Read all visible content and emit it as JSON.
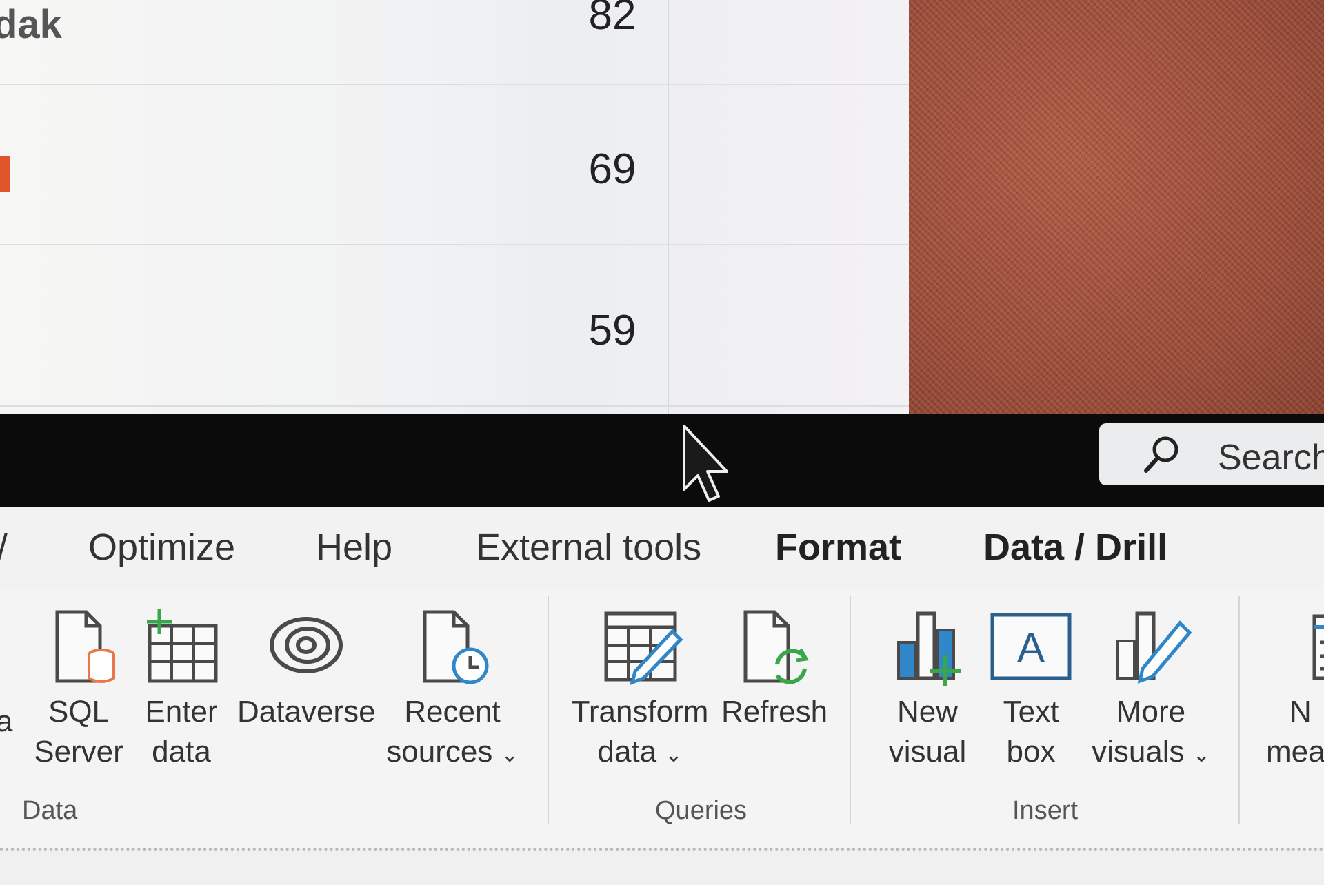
{
  "table": {
    "row_partial_label": "dak",
    "values": [
      "82",
      "69",
      "59"
    ],
    "accent_color": "#e0562a"
  },
  "title_bar": {
    "search": {
      "label": "Search",
      "icon": "search-icon"
    }
  },
  "menu": {
    "tabs": [
      {
        "label": "Optimize"
      },
      {
        "label": "Help"
      },
      {
        "label": "External tools"
      },
      {
        "label": "Format"
      },
      {
        "label": "Data / Drill"
      }
    ]
  },
  "ribbon": {
    "groups": {
      "data": "Data",
      "queries": "Queries",
      "insert": "Insert"
    },
    "buttons": {
      "partial_left": "a",
      "sql_server": {
        "line1": "SQL",
        "line2": "Server",
        "icon": "sql-server-icon"
      },
      "enter_data": {
        "line1": "Enter",
        "line2": "data",
        "icon": "enter-data-icon"
      },
      "dataverse": {
        "line1": "Dataverse",
        "icon": "dataverse-icon"
      },
      "recent_sources": {
        "line1": "Recent",
        "line2": "sources",
        "icon": "recent-sources-icon"
      },
      "transform_data": {
        "line1": "Transform",
        "line2": "data",
        "icon": "transform-data-icon"
      },
      "refresh": {
        "line1": "Refresh",
        "icon": "refresh-icon"
      },
      "new_visual": {
        "line1": "New",
        "line2": "visual",
        "icon": "new-visual-icon"
      },
      "text_box": {
        "line1": "Text",
        "line2": "box",
        "icon": "text-box-icon"
      },
      "more_visuals": {
        "line1": "More",
        "line2": "visuals",
        "icon": "more-visuals-icon"
      },
      "new_measure_partial": {
        "line1": "N",
        "line2": "mea",
        "icon": "new-measure-icon"
      }
    },
    "caret": "⌄"
  },
  "colors": {
    "title_bar": "#0b0b0b",
    "desktop": "#a6503a",
    "icon_outline": "#4a4a4a",
    "accent_blue": "#2f86c9",
    "accent_green": "#3aa64a",
    "accent_orange": "#e8784a"
  }
}
